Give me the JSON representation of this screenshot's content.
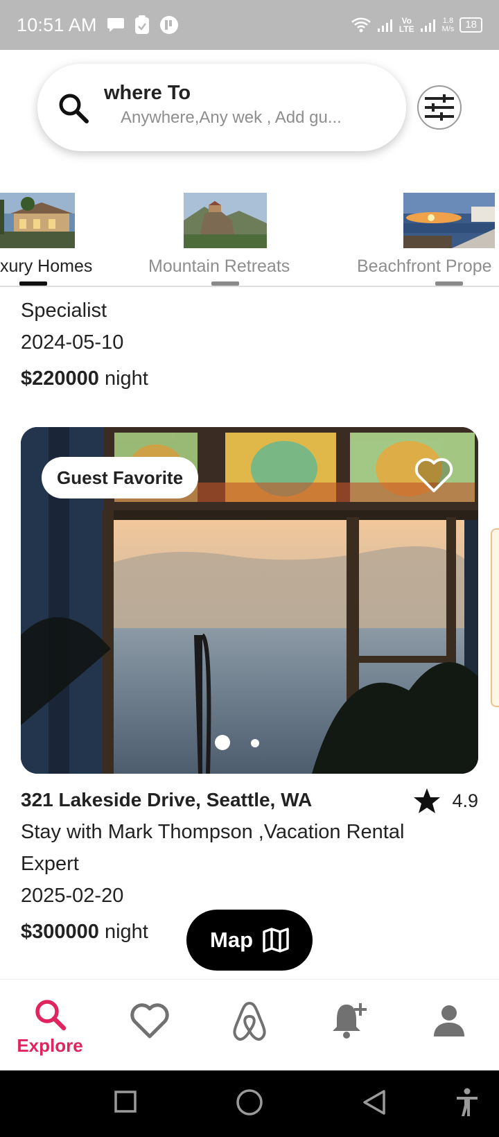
{
  "status_bar": {
    "time": "10:51 AM",
    "lte_top": "Vo",
    "lte_bottom": "LTE",
    "net_rate_top": "1.8",
    "net_rate_bottom": "M/s",
    "battery": "18"
  },
  "search": {
    "title": "where To",
    "subtitle": "Anywhere,Any wek , Add gu..."
  },
  "categories": [
    {
      "label": "xury Homes",
      "selected": true
    },
    {
      "label": "Mountain Retreats",
      "selected": false
    },
    {
      "label": "Beachfront Prope",
      "selected": false
    }
  ],
  "listing_prev": {
    "host_line_end": "Specialist",
    "date": "2024-05-10",
    "price": "$220000",
    "price_unit": " night"
  },
  "listing": {
    "badge": "Guest Favorite",
    "address": "321 Lakeside Drive, Seattle, WA",
    "rating": "4.9",
    "host_line1": "Stay with Mark Thompson ,Vacation Rental",
    "host_line2": "Expert",
    "date": "2025-02-20",
    "price": "$300000",
    "price_unit": " night",
    "carousel_pages": 2,
    "carousel_active": 1
  },
  "map_button": {
    "label": "Map"
  },
  "bottom_nav": [
    {
      "label": "Explore",
      "icon": "search-icon",
      "active": true
    },
    {
      "label": "",
      "icon": "heart-icon",
      "active": false
    },
    {
      "label": "",
      "icon": "airbnb-logo-icon",
      "active": false
    },
    {
      "label": "",
      "icon": "bell-add-icon",
      "active": false
    },
    {
      "label": "",
      "icon": "person-icon",
      "active": false
    }
  ],
  "colors": {
    "accent": "#e0245e",
    "status_bar": "#b9b9b9",
    "text": "#222222",
    "muted": "#8e8e8e"
  }
}
